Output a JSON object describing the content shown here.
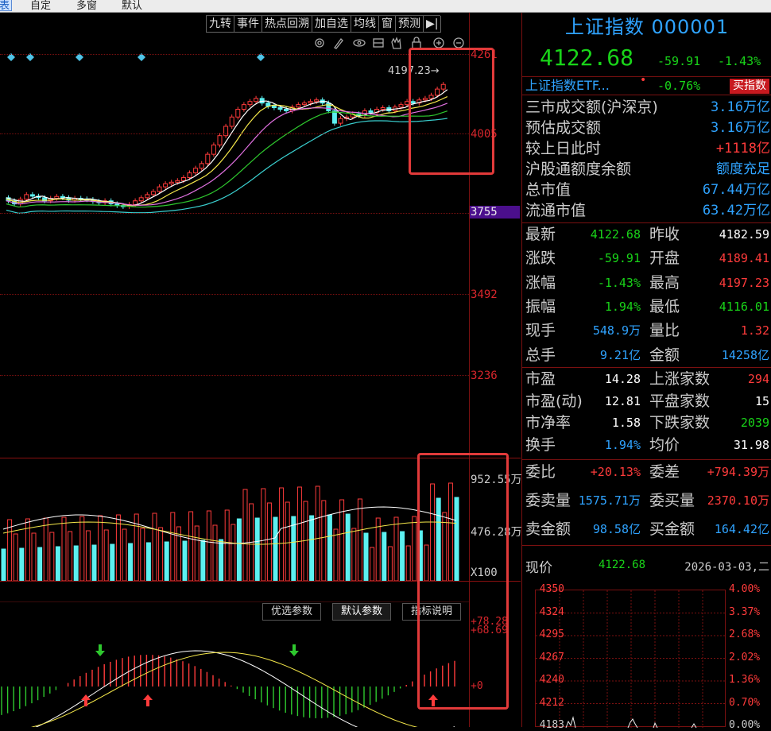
{
  "menubar": {
    "items": [
      "表",
      "自定",
      "多窗",
      "默认"
    ]
  },
  "toolbar": {
    "buttons": [
      "九转",
      "事件",
      "热点回溯",
      "加自选",
      "均线",
      "窗",
      "预测",
      "▶|"
    ]
  },
  "chart": {
    "price_axis": [
      "4261",
      "4005",
      "3755",
      "3492",
      "3236"
    ],
    "last_price_label": "4197.23→",
    "volume_axis": [
      "952.55万",
      "476.28万",
      "X100"
    ],
    "macd_axis": [
      "+78.28",
      "+68.69",
      "+0"
    ],
    "macd_buttons": [
      "优选参数",
      "默认参数",
      "指标说明"
    ]
  },
  "quote": {
    "title": "上证指数 000001",
    "price": "4122.68",
    "change": "-59.91",
    "pct": "-1.43%",
    "etf_name": "上证指数ETF...",
    "etf_dot": "•",
    "etf_pct": "-0.76%",
    "etf_btn": "买指数",
    "stats": [
      {
        "k": "三市成交额(沪深京)",
        "v": "3.16万亿"
      },
      {
        "k": "预估成交额",
        "v": "3.16万亿"
      },
      {
        "k": "较上日此时",
        "v": "+1118亿"
      },
      {
        "k": "沪股通额度余额",
        "v": "额度充足"
      },
      {
        "k": "总市值",
        "v": "67.44万亿"
      },
      {
        "k": "流通市值",
        "v": "63.42万亿"
      }
    ],
    "grid1": [
      [
        "最新",
        "4122.68",
        "昨收",
        "4182.59"
      ],
      [
        "涨跌",
        "-59.91",
        "开盘",
        "4189.41"
      ],
      [
        "涨幅",
        "-1.43%",
        "最高",
        "4197.23"
      ],
      [
        "振幅",
        "1.94%",
        "最低",
        "4116.01"
      ],
      [
        "现手",
        "548.9万",
        "量比",
        "1.32"
      ],
      [
        "总手",
        "9.21亿",
        "金额",
        "14258亿"
      ]
    ],
    "grid2": [
      [
        "市盈",
        "14.28",
        "上涨家数",
        "294"
      ],
      [
        "市盈(动)",
        "12.81",
        "平盘家数",
        "15"
      ],
      [
        "市净率",
        "1.58",
        "下跌家数",
        "2039"
      ],
      [
        "换手",
        "1.94%",
        "均价",
        "31.98"
      ]
    ],
    "grid3": [
      [
        "委比",
        "+20.13%",
        "委差",
        "+794.39万"
      ],
      [
        "委卖量",
        "1575.71万",
        "委买量",
        "2370.10万"
      ],
      [
        "卖金额",
        "98.58亿",
        "买金额",
        "164.42亿"
      ]
    ],
    "now_label": "现价",
    "now_value": "4122.68",
    "date": "2026-03-03,二",
    "mini_left": [
      "4350",
      "4324",
      "4295",
      "4267",
      "4240",
      "4212",
      "4183"
    ],
    "mini_right": [
      "4.00%",
      "3.37%",
      "2.68%",
      "2.02%",
      "1.36%",
      "0.70%",
      "0.00%"
    ]
  }
}
